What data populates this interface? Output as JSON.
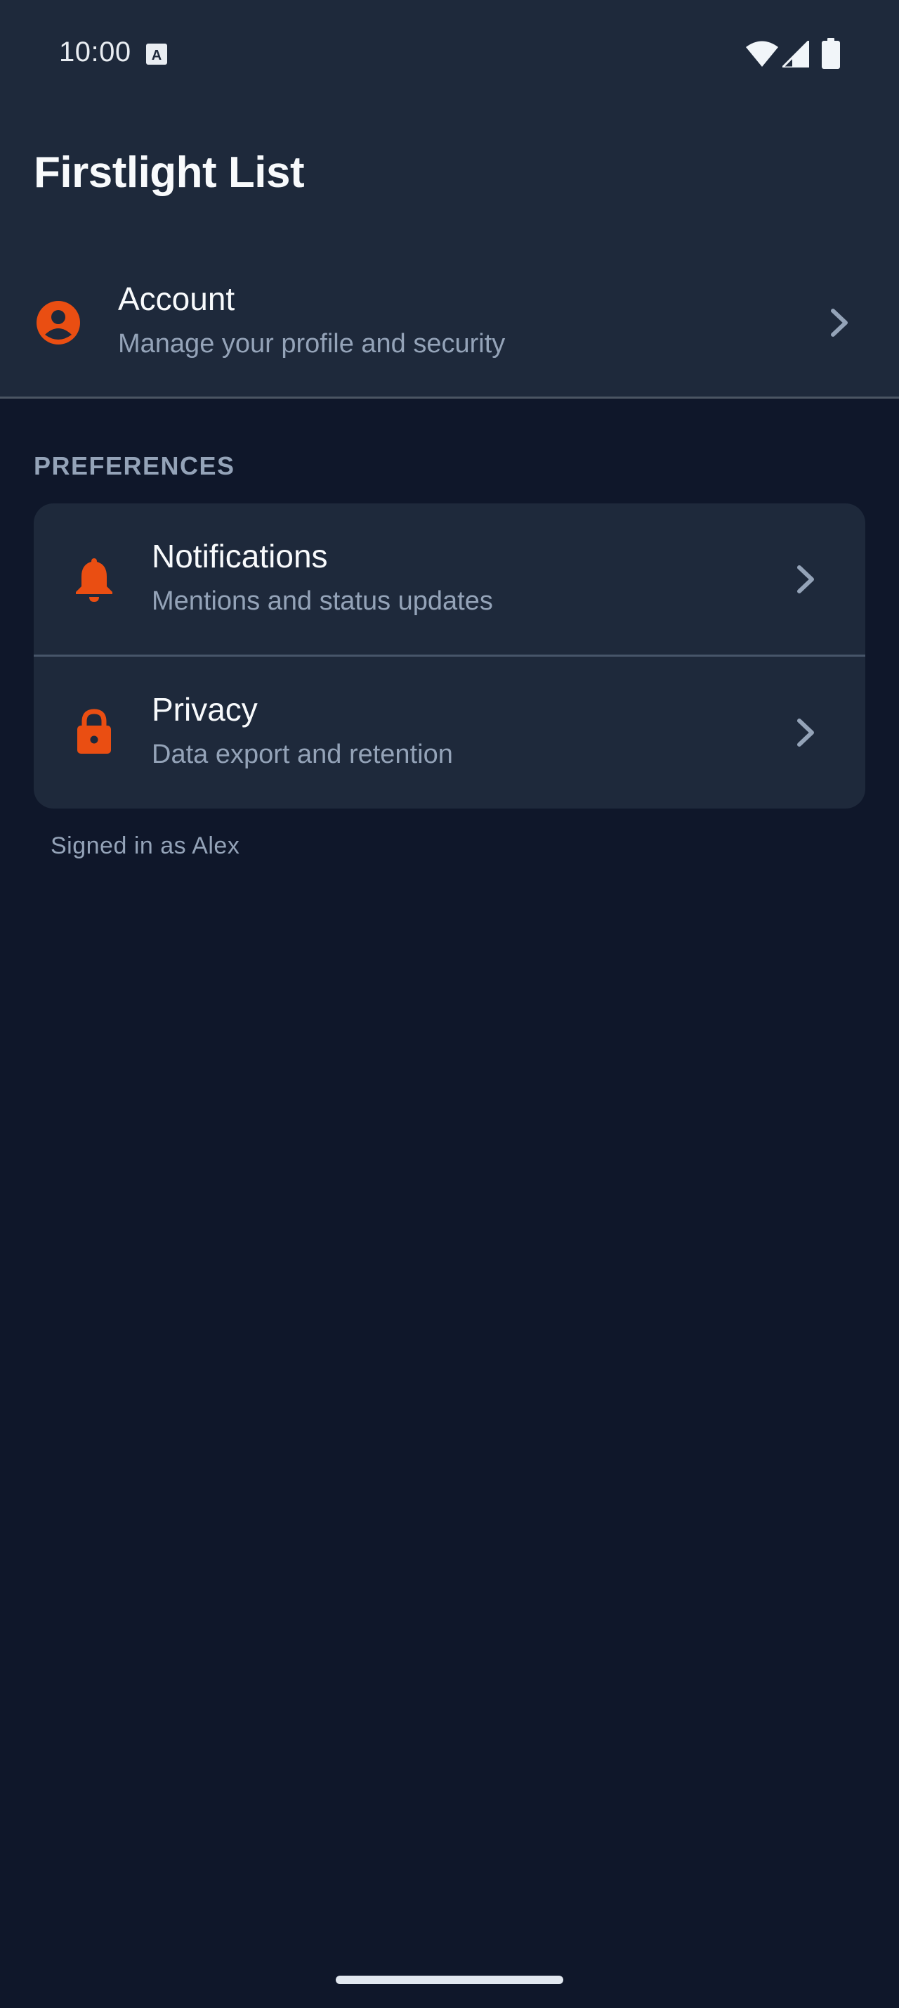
{
  "status_bar": {
    "time": "10:00",
    "icons": [
      "keyboard-a-icon",
      "wifi-icon",
      "cellular-signal-icon",
      "battery-icon"
    ]
  },
  "app": {
    "title": "Firstlight List"
  },
  "account": {
    "title": "Account",
    "subtitle": "Manage your profile and security",
    "icon": "account-circle-icon"
  },
  "preferences": {
    "section_label": "PREFERENCES",
    "items": [
      {
        "title": "Notifications",
        "subtitle": "Mentions and status updates",
        "icon": "bell-icon"
      },
      {
        "title": "Privacy",
        "subtitle": "Data export and retention",
        "icon": "lock-icon"
      }
    ]
  },
  "footer": {
    "signed_in": "Signed in as Alex"
  },
  "colors": {
    "accent": "#ea4e12",
    "background": "#0f172a",
    "surface": "#1e293b",
    "text_primary": "#f8fafc",
    "text_secondary": "#94a3b8"
  }
}
